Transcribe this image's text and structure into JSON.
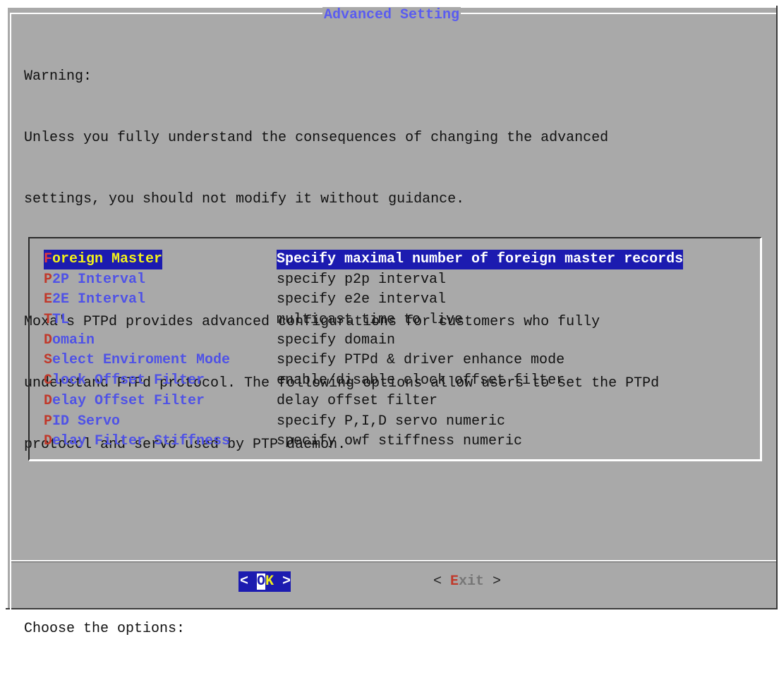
{
  "dialog": {
    "title": "Advanced Setting",
    "text_lines": [
      "Warning:",
      "Unless you fully understand the consequences of changing the advanced",
      "settings, you should not modify it without guidance.",
      "",
      "Moxa's PTPd provides advanced configurations for customers who fully",
      "understand PTPd protocol. The following options allow users to set the PTPd",
      "protocol and servo used by PTP daemon.",
      "",
      "",
      "Choose the options:"
    ]
  },
  "menu": {
    "selected_index": 0,
    "items": [
      {
        "hotkey": "F",
        "rest": "oreign Master",
        "description": "Specify maximal number of foreign master records"
      },
      {
        "hotkey": "P",
        "rest": "2P Interval",
        "description": "specify p2p interval"
      },
      {
        "hotkey": "E",
        "rest": "2E Interval",
        "description": "specify e2e interval"
      },
      {
        "hotkey": "T",
        "rest": "TL",
        "description": "multicast time to live"
      },
      {
        "hotkey": "D",
        "rest": "omain",
        "description": "specify domain"
      },
      {
        "hotkey": "S",
        "rest": "elect Enviroment Mode",
        "description": "specify PTPd & driver enhance mode"
      },
      {
        "hotkey": "C",
        "rest": "lock Offset Filter",
        "description": "enable/disable clock offset filter"
      },
      {
        "hotkey": "D",
        "rest": "elay Offset Filter",
        "description": "delay offset filter"
      },
      {
        "hotkey": "P",
        "rest": "ID Servo",
        "description": "specify P,I,D servo numeric"
      },
      {
        "hotkey": "D",
        "rest": "elay Filter Stiffness",
        "description": "specify owf stiffness numeric"
      }
    ]
  },
  "buttons": {
    "ok": {
      "left": "< ",
      "hotkey": "O",
      "rest": "K",
      "right": " >"
    },
    "exit": {
      "left": "< ",
      "hotkey": "E",
      "rest": "xit",
      "right": " >"
    }
  },
  "colors": {
    "dialog_bg": "#a9a9a9",
    "title": "#5a5cf0",
    "tag": "#4f52e6",
    "hotkey": "#c0392b",
    "selection_bg": "#1c1bb0",
    "selection_tag": "#f2f01a"
  }
}
